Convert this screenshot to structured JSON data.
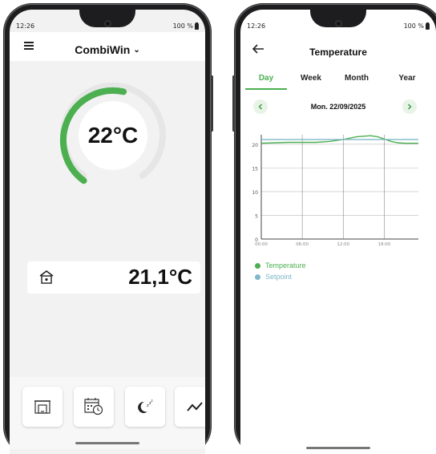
{
  "left_phone": {
    "status": {
      "time": "12:26",
      "battery": "100 %"
    },
    "header": {
      "title": "CombiWin"
    },
    "thermostat": {
      "setpoint": "22°C",
      "arc_fill_fraction": 0.62
    },
    "room": {
      "temperature": "21,1°C"
    },
    "tiles": [
      "fireplace-icon",
      "schedule-icon",
      "sleep-icon",
      "trend-icon"
    ]
  },
  "right_phone": {
    "status": {
      "time": "12:26",
      "battery": "100 %"
    },
    "header": {
      "title": "Temperature"
    },
    "tabs": [
      {
        "label": "Day",
        "active": true
      },
      {
        "label": "Week",
        "active": false
      },
      {
        "label": "Month",
        "active": false
      },
      {
        "label": "Year",
        "active": false
      }
    ],
    "date": "Mon. 22/09/2025",
    "legend": [
      {
        "label": "Temperature",
        "color": "#4caf50"
      },
      {
        "label": "Setpoint",
        "color": "#7fb8c8"
      }
    ]
  },
  "colors": {
    "accent": "#4caf50",
    "setpoint": "#7fb8c8"
  },
  "chart_data": {
    "type": "line",
    "x_ticks": [
      "00:00",
      "06:00",
      "12:00",
      "18:00"
    ],
    "y_ticks": [
      "0",
      "5",
      "10",
      "15",
      "20"
    ],
    "ylim": [
      0,
      22
    ],
    "xlim": [
      0,
      23
    ],
    "grid": true,
    "legend_position": "bottom-left",
    "series": [
      {
        "name": "Temperature",
        "color": "#4caf50",
        "x": [
          0,
          2,
          4,
          6,
          8,
          10,
          12,
          14,
          15,
          16,
          17,
          18,
          19,
          20,
          21,
          22,
          23
        ],
        "values": [
          20.2,
          20.3,
          20.4,
          20.4,
          20.4,
          20.6,
          21.0,
          21.6,
          21.7,
          21.8,
          21.6,
          21.1,
          20.6,
          20.3,
          20.2,
          20.2,
          20.2
        ]
      },
      {
        "name": "Setpoint",
        "color": "#7fb8c8",
        "x": [
          0,
          23
        ],
        "values": [
          21.0,
          21.0
        ]
      }
    ]
  }
}
